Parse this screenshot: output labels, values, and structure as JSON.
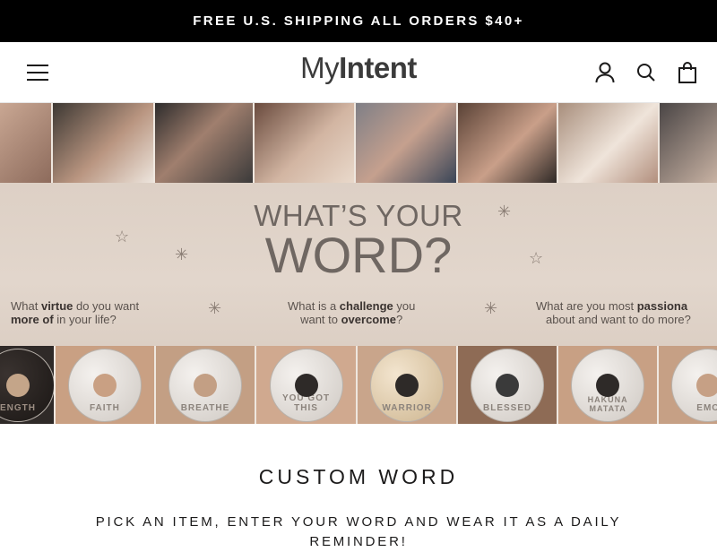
{
  "announcement": {
    "text": "FREE U.S. SHIPPING ALL ORDERS $40+"
  },
  "header": {
    "logo_my": "My",
    "logo_intent": "Intent",
    "icons": [
      "hamburger-icon",
      "account-icon",
      "search-icon",
      "cart-icon"
    ]
  },
  "hero": {
    "title_line1": "WHAT’S YOUR",
    "title_line2": "WORD?",
    "questions": [
      {
        "pre": "What ",
        "bold1": "virtue",
        "mid": " do you want",
        "bold2": "more of",
        "post": " in your life?"
      },
      {
        "pre": "What is a ",
        "bold1": "challenge",
        "mid": " you",
        "pre2": "want to ",
        "bold2": "overcome",
        "post": "?"
      },
      {
        "pre": "What are you most ",
        "bold1": "passiona",
        "line2": "about and want to do more?"
      }
    ],
    "charm_words": [
      "ENGTH",
      "FAITH",
      "BREATHE",
      "YOU GOT THIS",
      "WARRIOR",
      "BLESSED",
      "HAKUNA MATATA",
      "EMO"
    ]
  },
  "section": {
    "title": "CUSTOM WORD",
    "subtitle": "PICK AN ITEM, ENTER YOUR WORD AND WEAR IT AS A DAILY REMINDER!"
  }
}
